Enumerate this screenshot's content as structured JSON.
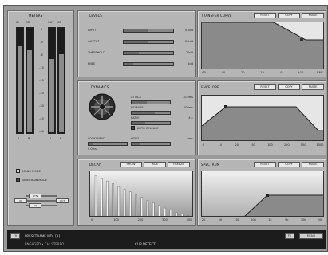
{
  "meters": {
    "title": "METERS",
    "col_labels": [
      "IN",
      "GR",
      "OUT",
      "GR"
    ],
    "scale": [
      "0",
      "-3",
      "-6",
      "-10",
      "-15",
      "-20",
      "-30",
      "-40",
      "-60"
    ],
    "foot_labels": [
      "L",
      "R",
      "L",
      "R"
    ],
    "levels": [
      0.82,
      0.78,
      0.7,
      0.74
    ]
  },
  "options": {
    "items": [
      {
        "label": "MONO MODE",
        "checked": false
      },
      {
        "label": "SIDECHAIN MODE",
        "checked": true
      }
    ]
  },
  "routing": {
    "nodes": [
      "IN",
      "DYN",
      "EQ",
      "OUT"
    ]
  },
  "levels": {
    "title": "LEVELS",
    "rows": [
      {
        "label": "INPUT",
        "value": "0.0dB",
        "fraction": 0.5
      },
      {
        "label": "OUTPUT",
        "value": "0.0dB",
        "fraction": 0.5
      },
      {
        "label": "THRESHOLD",
        "value": "-20dB",
        "fraction": 0.3
      },
      {
        "label": "KNEE",
        "value": "6dB",
        "fraction": 0.2
      }
    ]
  },
  "transfer": {
    "title": "TRANSFER CURVE",
    "buttons": [
      "RESET",
      "COPY",
      "PASTE"
    ],
    "x_ticks": [
      "-60",
      "-40",
      "-20",
      "-10",
      "0",
      "+10",
      "RMS"
    ]
  },
  "dynamics": {
    "title": "DYNAMICS",
    "rows": [
      {
        "label": "ATTACK",
        "value": "10.0ms",
        "fraction": 0.4
      },
      {
        "label": "RELEASE",
        "value": "100ms",
        "fraction": 0.6
      },
      {
        "label": "RATIO",
        "value": "4:1",
        "fraction": 0.35
      }
    ],
    "checkbox": {
      "label": "AUTO RELEASE",
      "checked": true
    },
    "lookahead": {
      "label": "LOOKAHEAD",
      "value": "0.0ms",
      "fraction": 0.1
    },
    "hold": {
      "label": "HOLD",
      "value": "0ms",
      "fraction": 0.2
    }
  },
  "envelope": {
    "title": "ENVELOPE",
    "buttons": [
      "RESET",
      "COPY",
      "PASTE"
    ],
    "x_ticks": [
      "0",
      "10",
      "20",
      "50",
      "100",
      "200",
      "500",
      "1000"
    ]
  },
  "decay": {
    "title": "DECAY",
    "buttons": [
      "SHOW",
      "HIDE",
      "FREEZE"
    ],
    "x_ticks": [
      "0",
      "100",
      "200",
      "300",
      "400"
    ],
    "bars": [
      0.98,
      0.92,
      0.85,
      0.79,
      0.72,
      0.66,
      0.6,
      0.53,
      0.47,
      0.4,
      0.34,
      0.28,
      0.22,
      0.17,
      0.12,
      0.08,
      0.05
    ]
  },
  "spectrum": {
    "title": "SPECTRUM",
    "buttons": [
      "RESET",
      "COPY",
      "PASTE"
    ],
    "x_ticks": [
      "20",
      "50",
      "100",
      "500",
      "1k",
      "5k",
      "10k",
      "20k"
    ]
  },
  "status": {
    "left_badge": "FX",
    "preset": "PRESETNAME.MDL [A]",
    "line2": "ENGAGED • CH: STEREO",
    "center": "CLIP DETECT",
    "right_badge": "FX",
    "right_btn": "MENU"
  },
  "colors": {
    "panel": "#b5b5b5",
    "graph_bg": "#e6e6e6",
    "graph_fill": "#8a8a8a",
    "status_bg": "#1c1c1c"
  }
}
